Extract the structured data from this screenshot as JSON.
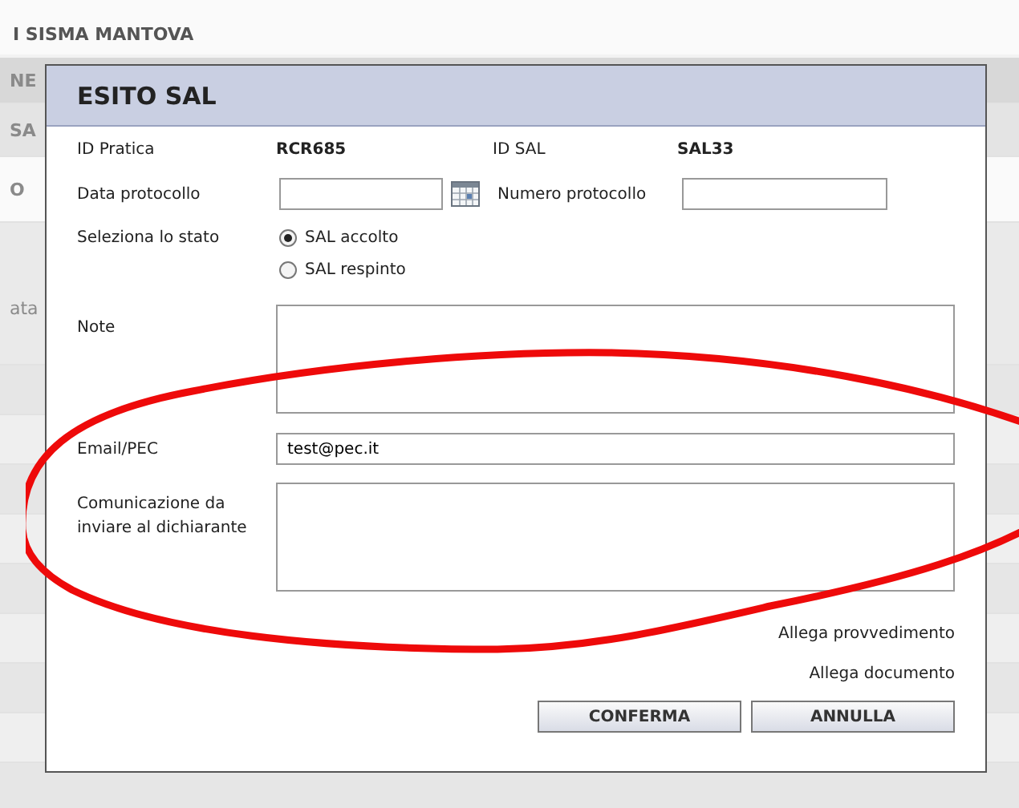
{
  "background": {
    "subtitle": "I SISMA MANTOVA",
    "side_fragments": [
      "NE",
      "SA",
      "O",
      "ata"
    ]
  },
  "dialog": {
    "title": "ESITO SAL",
    "info": [
      {
        "label": "ID Pratica",
        "value": "RCR685"
      },
      {
        "label": "ID SAL",
        "value": "SAL33"
      }
    ],
    "data_protocollo": {
      "label": "Data protocollo"
    },
    "numero_protocollo": {
      "label": "Numero protocollo"
    },
    "stato": {
      "label": "Seleziona lo stato",
      "options": [
        {
          "label": "SAL accolto",
          "selected": true
        },
        {
          "label": "SAL respinto",
          "selected": false
        }
      ]
    },
    "note": {
      "label": "Note"
    },
    "email": {
      "label": "Email/PEC",
      "value": "test@pec.it"
    },
    "comunicazione": {
      "label": "Comunicazione da inviare al dichiarante"
    },
    "links": [
      "Allega provvedimento",
      "Allega documento"
    ],
    "buttons": [
      "CONFERMA",
      "ANNULLA"
    ]
  }
}
